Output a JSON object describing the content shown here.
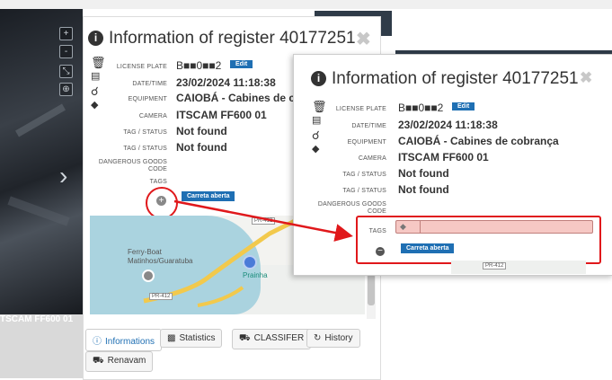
{
  "camera": {
    "label": "TSCAM FF600 01",
    "buttons": [
      "+",
      "-",
      "⤡",
      "⊕"
    ],
    "next_icon": "chevron-right-icon"
  },
  "panel_back": {
    "title": "Information of register 40177251",
    "close": "✖",
    "labels": {
      "plate": "LICENSE PLATE",
      "datetime": "DATE/TIME",
      "equipment": "EQUIPMENT",
      "camera": "CAMERA",
      "tag1": "TAG / STATUS",
      "tag2": "TAG / STATUS",
      "dangerous": "DANGEROUS GOODS CODE",
      "tags": "TAGS"
    },
    "values": {
      "plate": "B■■0■■2",
      "datetime": "23/02/2024 11:18:38",
      "equipment": "CAIOBÁ - Cabines de c",
      "camera": "ITSCAM FF600 01",
      "tag1": "Not found",
      "tag2": "Not found"
    },
    "edit_label": "Edit",
    "tag_button": "Carreta aberta",
    "plus": "+",
    "map": {
      "place1": "Ferry-Boat",
      "place2": "Matinhos/Guaratuba",
      "place3": "Prainha",
      "road1": "PR-412",
      "road2": "PR-412"
    }
  },
  "tabs": [
    {
      "label": "Informations",
      "icon": "info-icon"
    },
    {
      "label": "Statistics",
      "icon": "bar-chart-icon"
    },
    {
      "label": "CLASSIFER",
      "icon": "car-icon"
    },
    {
      "label": "History",
      "icon": "history-icon"
    },
    {
      "label": "Renavam",
      "icon": "car-icon"
    }
  ],
  "panel_front": {
    "title": "Information of register 40177251",
    "close": "✖",
    "labels": {
      "plate": "LICENSE PLATE",
      "datetime": "DATE/TIME",
      "equipment": "EQUIPMENT",
      "camera": "CAMERA",
      "tag1": "TAG / STATUS",
      "tag2": "TAG / STATUS",
      "dangerous": "DANGEROUS GOODS CODE",
      "tags": "TAGS"
    },
    "values": {
      "plate": "B■■0■■2",
      "datetime": "23/02/2024 11:18:38",
      "equipment": "CAIOBÁ - Cabines de cobrança",
      "camera": "ITSCAM FF600 01",
      "tag1": "Not found",
      "tag2": "Not found"
    },
    "edit_label": "Edit",
    "tag_button": "Carreta aberta",
    "minus": "−",
    "road": "PR-412"
  },
  "colors": {
    "accent": "#1f6fb3",
    "annotation": "#e0181b",
    "tag_input_bg": "#f6c8c4"
  }
}
